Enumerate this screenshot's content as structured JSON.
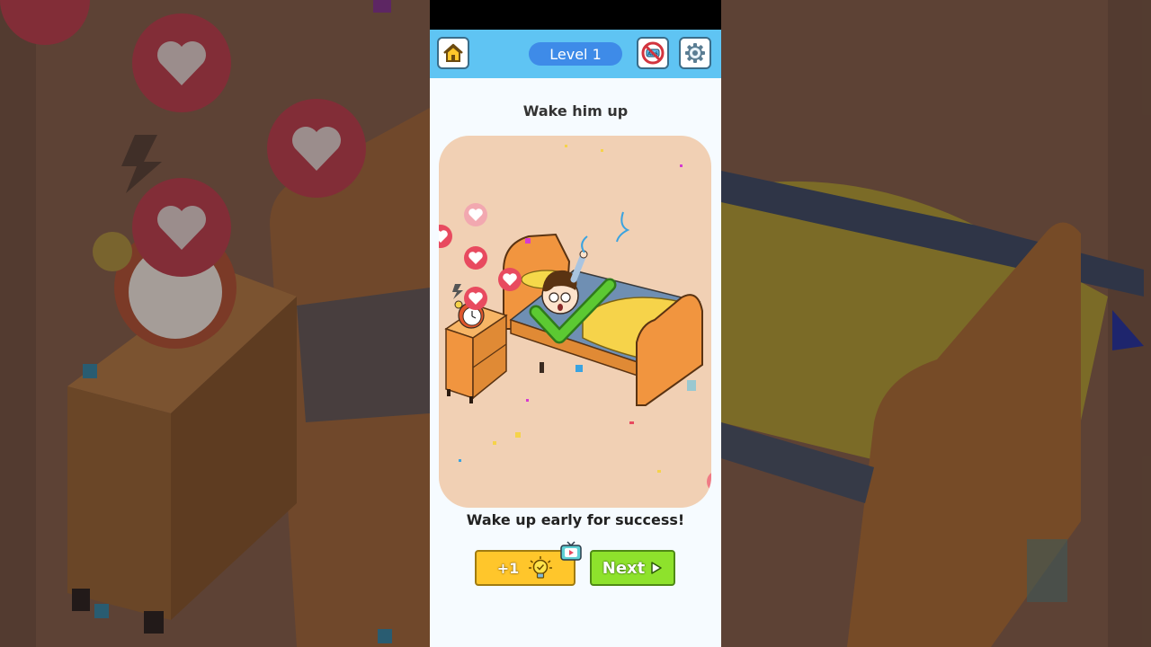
{
  "header": {
    "level_label": "Level 1",
    "home_icon": "home-icon",
    "no_ads_icon": "no-ads-icon",
    "no_ads_text": "ADS",
    "settings_icon": "gear-icon"
  },
  "puzzle": {
    "title": "Wake him up",
    "result_caption": "Wake up early for success!",
    "status": "solved",
    "result_icon": "check-mark-icon"
  },
  "actions": {
    "hint_label": "+1",
    "hint_icon": "lightbulb-icon",
    "video_icon": "tv-video-icon",
    "next_label": "Next",
    "next_icon": "play-triangle-icon"
  },
  "colors": {
    "topbar": "#5fc4f3",
    "level_pill": "#3e8be8",
    "scene_bg": "#f1d0b4",
    "hint_button": "#ffc62b",
    "next_button": "#8ee22c",
    "check": "#5cc932",
    "heart_badge": "#e84a5f"
  }
}
